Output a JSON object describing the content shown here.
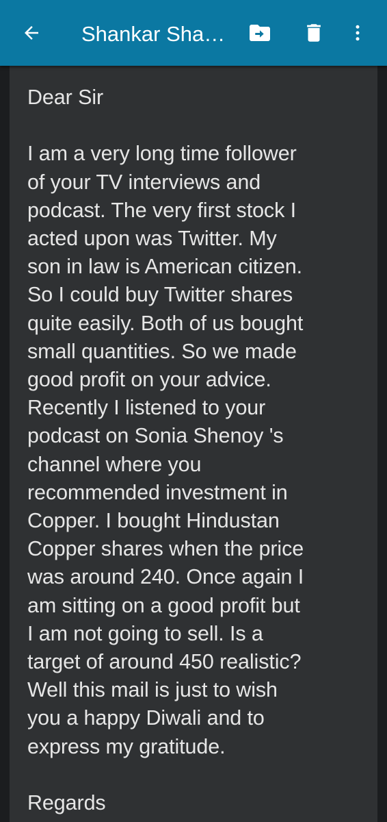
{
  "header": {
    "title": "Shankar Sha…",
    "icons": [
      "arrow-left-icon",
      "move-to-folder-icon",
      "trash-icon",
      "more-vertical-icon"
    ],
    "background_color": "#0b78a2"
  },
  "email": {
    "greeting": "Dear Sir",
    "body_lines": [
      "I am a very long time follower",
      "of your TV interviews and",
      "podcast. The very first stock I",
      "acted upon was Twitter. My",
      "son in law is American citizen.",
      "So I could buy Twitter shares",
      "quite easily. Both of us bought",
      "small quantities. So we made",
      "good profit on your advice.",
      "Recently I listened to your",
      "podcast on Sonia Shenoy 's",
      "channel where you",
      "recommended investment in",
      "Copper. I bought Hindustan",
      "Copper shares when the price",
      "was around 240. Once again I",
      "am sitting on a good profit but",
      "I am not going to sell. Is a",
      "target of around 450 realistic?",
      "Well this mail is just to wish",
      "you a happy Diwali and to",
      "express my gratitude."
    ],
    "signoff": "Regards"
  }
}
